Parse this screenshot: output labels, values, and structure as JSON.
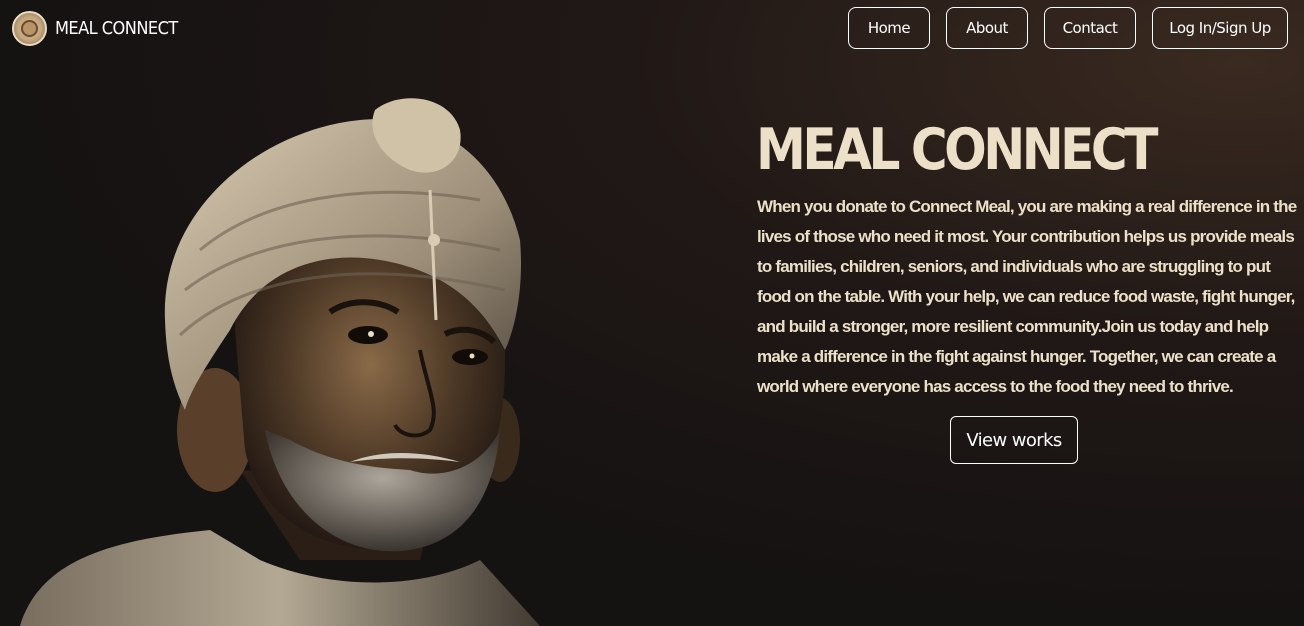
{
  "brand": {
    "name": "MEAL CONNECT",
    "logo_icon": "meal-connect-logo"
  },
  "nav": {
    "home": "Home",
    "about": "About",
    "contact": "Contact",
    "login": "Log In/Sign Up"
  },
  "hero": {
    "title": "MEAL CONNECT",
    "description": "When you donate to Connect Meal, you are making a real difference in the lives of those who need it most. Your contribution helps us provide meals to families, children, seniors, and individuals who are struggling to put food on the table. With your help, we can reduce food waste, fight hunger, and build a stronger, more resilient community.Join us today and help make a difference in the fight against hunger. Together, we can create a world where everyone has access to the food they need to thrive.",
    "cta": "View works"
  },
  "colors": {
    "background": "#151212",
    "accent_text": "#ece0c8",
    "button_border": "#ffffff"
  }
}
